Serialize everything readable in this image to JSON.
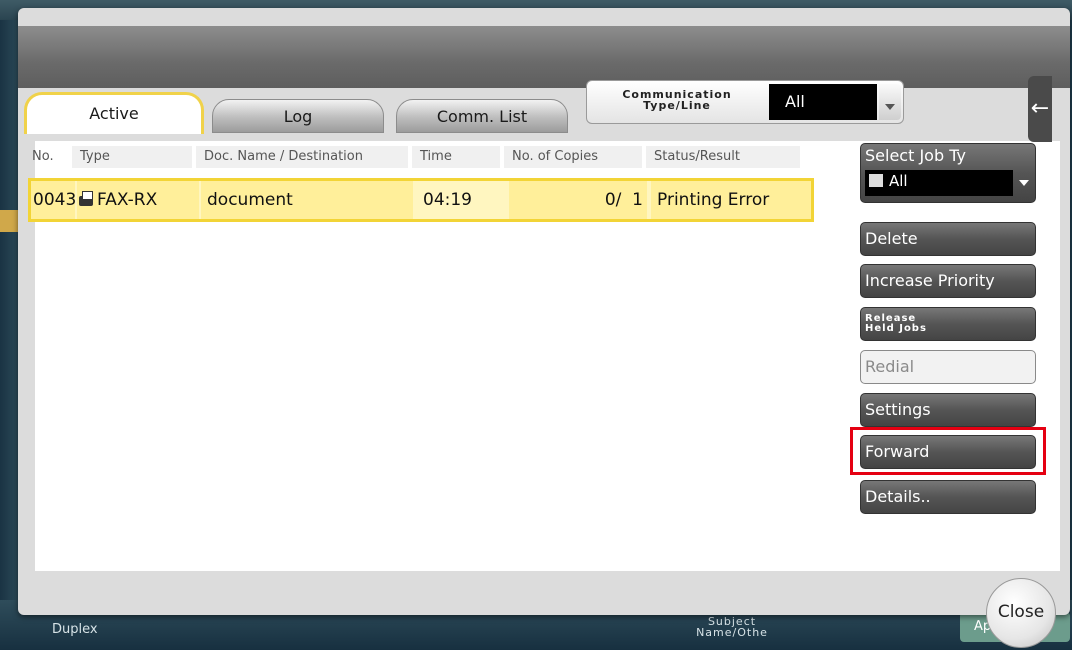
{
  "background": {
    "bottom_labels": [
      "Duplex",
      "Subject Name/Othe",
      "Ap"
    ]
  },
  "tabs": [
    {
      "label": "Active"
    },
    {
      "label": "Log"
    },
    {
      "label": "Comm. List"
    }
  ],
  "comm_type": {
    "label": "Communication Type/Line",
    "value": "All"
  },
  "table": {
    "columns": [
      "No.",
      "Type",
      "Doc. Name / Destination",
      "Time",
      "No. of Copies",
      "Status/Result"
    ],
    "rows": [
      {
        "no": "0043",
        "type": "FAX-RX",
        "doc": "document",
        "time": "04:19",
        "copies": "0/  1",
        "status": "Printing Error"
      }
    ]
  },
  "side": {
    "select_job_label": "Select Job Ty",
    "select_job_value": "All",
    "buttons": [
      "Delete",
      "Increase Priority",
      "Release Held Jobs",
      "Redial",
      "Settings",
      "Forward",
      "Details.."
    ]
  },
  "close_label": "Close",
  "colors": {
    "highlight": "#e50012",
    "active_tab_border": "#f0d24a",
    "selected_row": "#fff6c0"
  }
}
